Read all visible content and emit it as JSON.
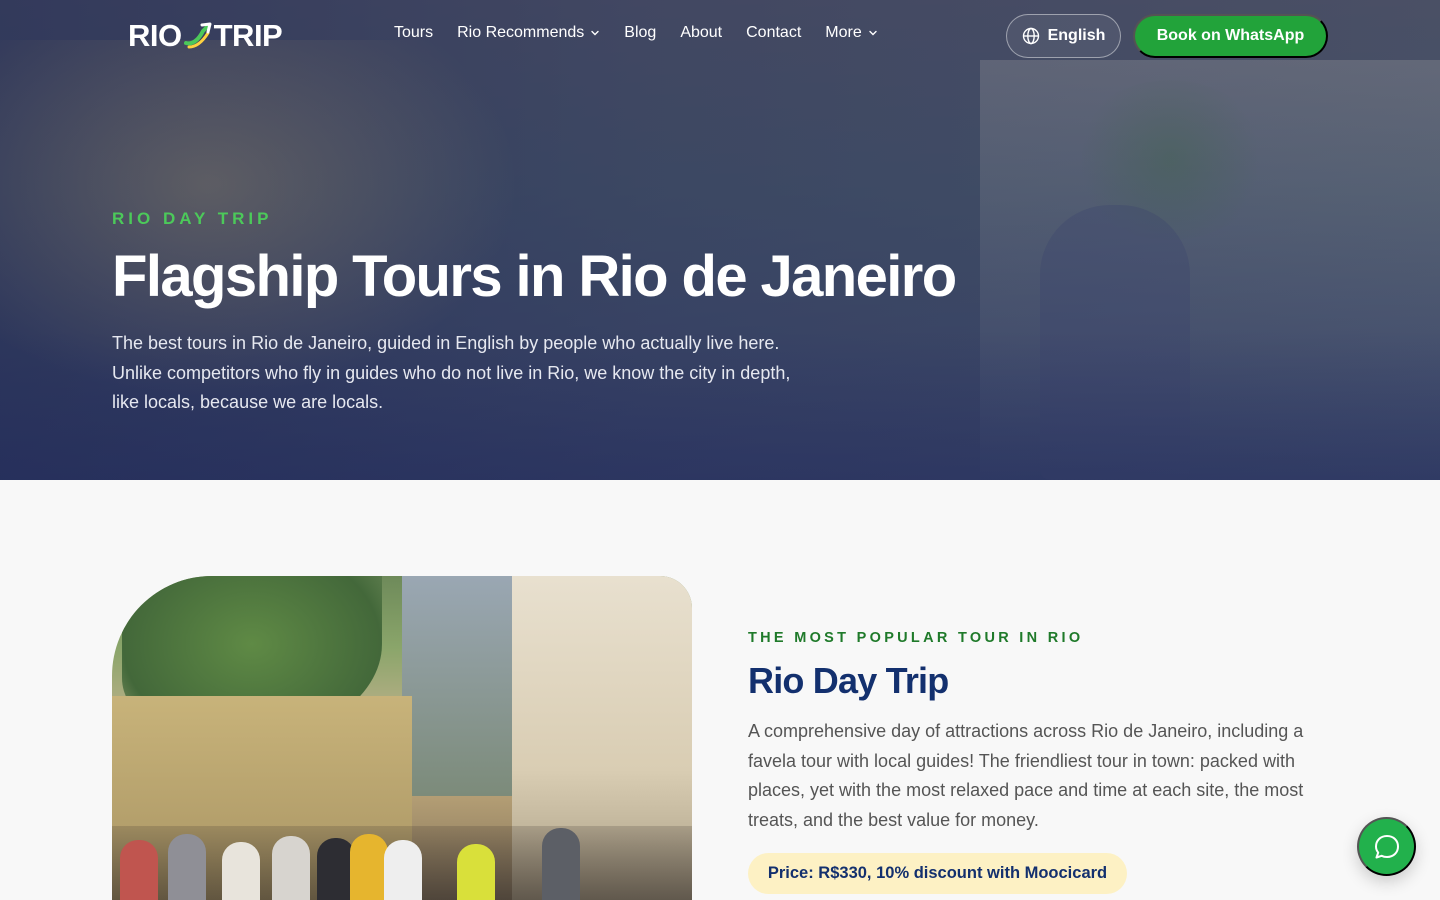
{
  "nav": {
    "logo_left": "RIO",
    "logo_right": "TRIP",
    "links": [
      {
        "label": "Tours"
      },
      {
        "label": "Rio Recommends"
      },
      {
        "label": "Blog"
      },
      {
        "label": "About"
      },
      {
        "label": "Contact"
      },
      {
        "label": "More"
      }
    ],
    "language_label": "English",
    "cta_label": "Book on WhatsApp"
  },
  "hero": {
    "eyebrow": "RIO DAY TRIP",
    "title": "Flagship Tours in Rio de Janeiro",
    "description": "The best tours in Rio de Janeiro, guided in English by people who actually live here. Unlike competitors who fly in guides who do not live in Rio, we know the city in depth, like locals, because we are locals."
  },
  "feature": {
    "eyebrow": "THE MOST POPULAR TOUR IN RIO",
    "title": "Rio Day Trip",
    "description": "A comprehensive day of attractions across Rio de Janeiro, including a favela tour with local guides! The friendliest tour in town: packed with places, yet with the most relaxed pace and time at each site, the most treats, and the best value for money.",
    "price": "Price: R$330, 10% discount with Moocicard"
  },
  "colors": {
    "brand_green": "#22a33a",
    "navy": "#13306e",
    "eyebrow_green": "#4cc95a",
    "price_bg": "#fdf1c4"
  },
  "icons": [
    "globe-icon",
    "chevron-down-icon",
    "chat-bubble-icon",
    "logo-swoosh-icon"
  ]
}
